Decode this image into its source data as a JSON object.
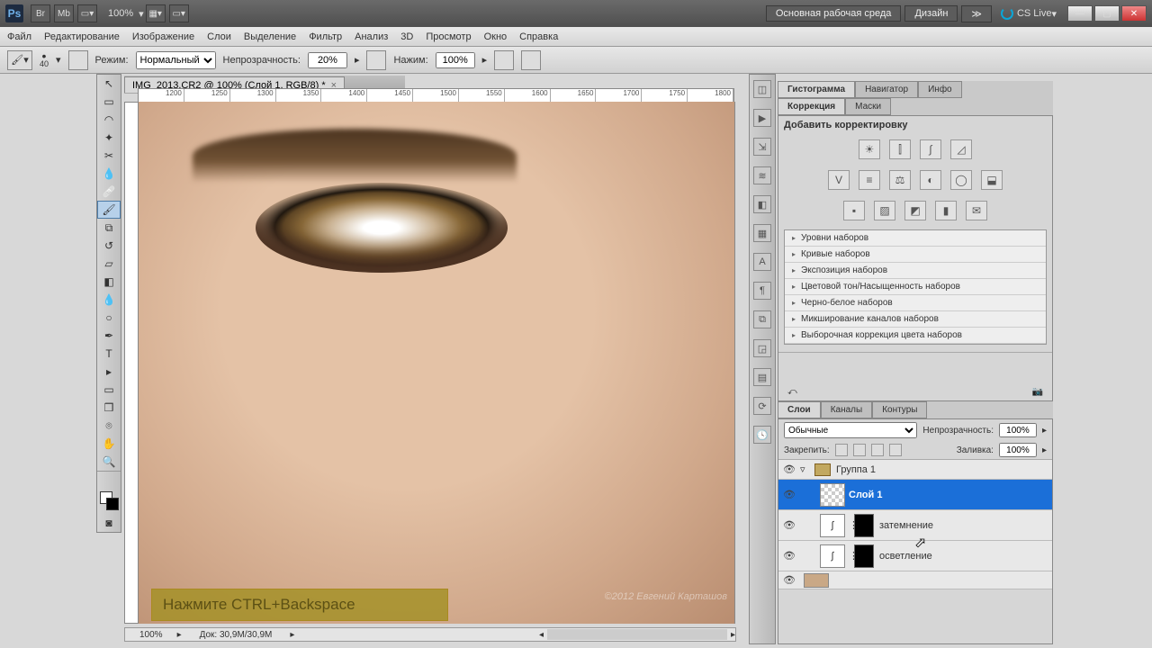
{
  "titlebar": {
    "ps": "Ps",
    "zoom": "100%",
    "workspace_main": "Основная рабочая среда",
    "workspace_design": "Дизайн",
    "cslive": "CS Live"
  },
  "menu": [
    "Файл",
    "Редактирование",
    "Изображение",
    "Слои",
    "Выделение",
    "Фильтр",
    "Анализ",
    "3D",
    "Просмотр",
    "Окно",
    "Справка"
  ],
  "options": {
    "brush_size": "40",
    "mode_label": "Режим:",
    "mode_value": "Нормальный",
    "opacity_label": "Непрозрачность:",
    "opacity_value": "20%",
    "flow_label": "Нажим:",
    "flow_value": "100%"
  },
  "tab": {
    "title": "IMG_2013.CR2 @ 100% (Слой 1, RGB/8) *"
  },
  "ruler_marks": [
    "1200",
    "1250",
    "1300",
    "1350",
    "1400",
    "1450",
    "1500",
    "1550",
    "1600",
    "1650",
    "1700",
    "1750",
    "1800"
  ],
  "tooltip": "Нажмите CTRL+Backspace",
  "status": {
    "zoom": "100%",
    "doc": "Док: 30,9M/30,9M"
  },
  "panels": {
    "top_tabs": [
      "Гистограмма",
      "Навигатор",
      "Инфо"
    ],
    "mid_tabs": [
      "Коррекция",
      "Маски"
    ],
    "adjust_title": "Добавить корректировку",
    "preset_items": [
      "Уровни наборов",
      "Кривые наборов",
      "Экспозиция наборов",
      "Цветовой тон/Насыщенность наборов",
      "Черно-белое наборов",
      "Микширование каналов наборов",
      "Выборочная коррекция цвета наборов"
    ],
    "layer_tabs": [
      "Слои",
      "Каналы",
      "Контуры"
    ],
    "blend_mode": "Обычные",
    "opacity_label": "Непрозрачность:",
    "opacity_value": "100%",
    "lock_label": "Закрепить:",
    "fill_label": "Заливка:",
    "fill_value": "100%",
    "layers": {
      "group": "Группа 1",
      "layer1": "Слой 1",
      "darken": "затемнение",
      "lighten": "осветление"
    }
  },
  "watermark": "©2012 Евгений Карташов"
}
